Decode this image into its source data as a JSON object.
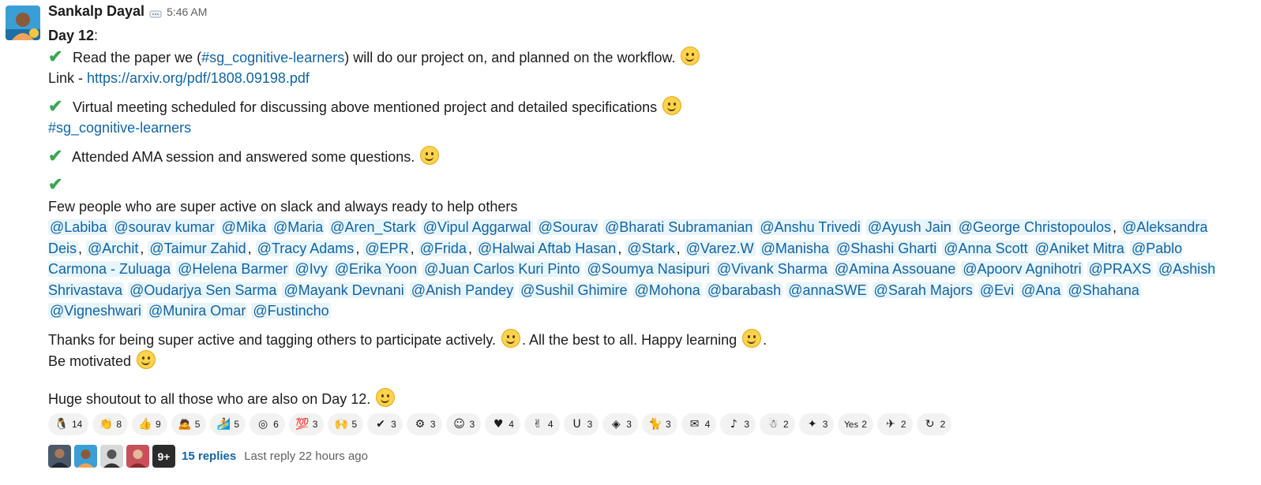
{
  "message": {
    "author": "Sankalp Dayal",
    "time": "5:46 AM",
    "day_label": "Day 12",
    "day_suffix": ":",
    "item1_text_a": " Read the paper we (",
    "item1_channel": "#sg_cognitive-learners",
    "item1_text_b": ") will do our project on, and planned on the workflow. ",
    "link_prefix": "Link - ",
    "link_url": "https://arxiv.org/pdf/1808.09198.pdf",
    "item2_text": " Virtual meeting scheduled for discussing above mentioned project and detailed specifications ",
    "item2_channel": "#sg_cognitive-learners",
    "item3_text": " Attended AMA session and answered some questions. ",
    "few_people": "Few people who are super active on slack and always ready to help others",
    "mentions": [
      "@Labiba",
      "@sourav kumar",
      "@Mika",
      "@Maria",
      "@Aren_Stark",
      "@Vipul Aggarwal",
      "@Sourav",
      "@Bharati Subramanian",
      "@Anshu Trivedi",
      "@Ayush Jain",
      "@George Christopoulos",
      "@Aleksandra Deis",
      "@Archit",
      "@Taimur Zahid",
      "@Tracy Adams",
      "@EPR",
      "@Frida",
      "@Halwai Aftab Hasan",
      "@Stark",
      "@Varez.W",
      "@Manisha",
      "@Shashi Gharti",
      "@Anna Scott",
      "@Aniket Mitra",
      "@Pablo Carmona - Zuluaga",
      "@Helena Barmer",
      "@Ivy",
      "@Erika Yoon",
      "@Juan Carlos Kuri Pinto",
      "@Soumya Nasipuri",
      "@Vivank Sharma",
      "@Amina Assouane",
      "@Apoorv Agnihotri",
      "@PRAXS",
      "@Ashish Shrivastava",
      "@Oudarjya Sen Sarma",
      "@Mayank Devnani",
      "@Anish Pandey",
      "@Sushil Ghimire",
      "@Mohona",
      "@barabash",
      "@annaSWE",
      "@Sarah Majors",
      "@Evi",
      "@Ana",
      "@Shahana",
      "@Vigneshwari",
      "@Munira Omar",
      "@Fustincho"
    ],
    "thanks_a": "Thanks for being super active and tagging others to participate actively. ",
    "thanks_b": ". All the best to all. Happy learning ",
    "thanks_c": ".",
    "motivated": "Be motivated ",
    "shoutout": "Huge shoutout to all those who are also on Day 12. "
  },
  "reactions": [
    {
      "icon": "penguin-icon",
      "glyph": "🐧",
      "count": "14"
    },
    {
      "icon": "clap-icon",
      "glyph": "👏",
      "count": "8"
    },
    {
      "icon": "thumbs-up-icon",
      "glyph": "👍",
      "count": "9"
    },
    {
      "icon": "person-icon",
      "glyph": "🙇",
      "count": "5"
    },
    {
      "icon": "surfer-icon",
      "glyph": "🏄",
      "count": "5"
    },
    {
      "icon": "target-icon",
      "glyph": "◎",
      "count": "6"
    },
    {
      "icon": "hundred-icon",
      "glyph": "💯",
      "count": "3"
    },
    {
      "icon": "raised-hands-icon",
      "glyph": "🙌",
      "count": "5"
    },
    {
      "icon": "check-icon",
      "glyph": "✔",
      "count": "3"
    },
    {
      "icon": "robot-icon",
      "glyph": "⚙",
      "count": "3"
    },
    {
      "icon": "smile-icon",
      "glyph": "☺",
      "count": "3"
    },
    {
      "icon": "heart-icon",
      "glyph": "♥",
      "count": "4"
    },
    {
      "icon": "victory-icon",
      "glyph": "✌",
      "count": "4"
    },
    {
      "icon": "udacity-icon",
      "glyph": "U",
      "count": "3"
    },
    {
      "icon": "udacity-shield-icon",
      "glyph": "◈",
      "count": "3"
    },
    {
      "icon": "cat-icon",
      "glyph": "🐈",
      "count": "3"
    },
    {
      "icon": "thank-you-icon",
      "glyph": "✉",
      "count": "4"
    },
    {
      "icon": "dancer-icon",
      "glyph": "♪",
      "count": "3"
    },
    {
      "icon": "blue-figure-icon",
      "glyph": "☃",
      "count": "2"
    },
    {
      "icon": "parrot-icon",
      "glyph": "✦",
      "count": "3"
    },
    {
      "icon": "yes-icon",
      "glyph": "Yes",
      "count": "2"
    },
    {
      "icon": "superhero-icon",
      "glyph": "✈",
      "count": "2"
    },
    {
      "icon": "loading-icon",
      "glyph": "↻",
      "count": "2"
    }
  ],
  "thread": {
    "more_label": "9+",
    "reply_count": "15 replies",
    "last_reply": "Last reply 22 hours ago"
  }
}
